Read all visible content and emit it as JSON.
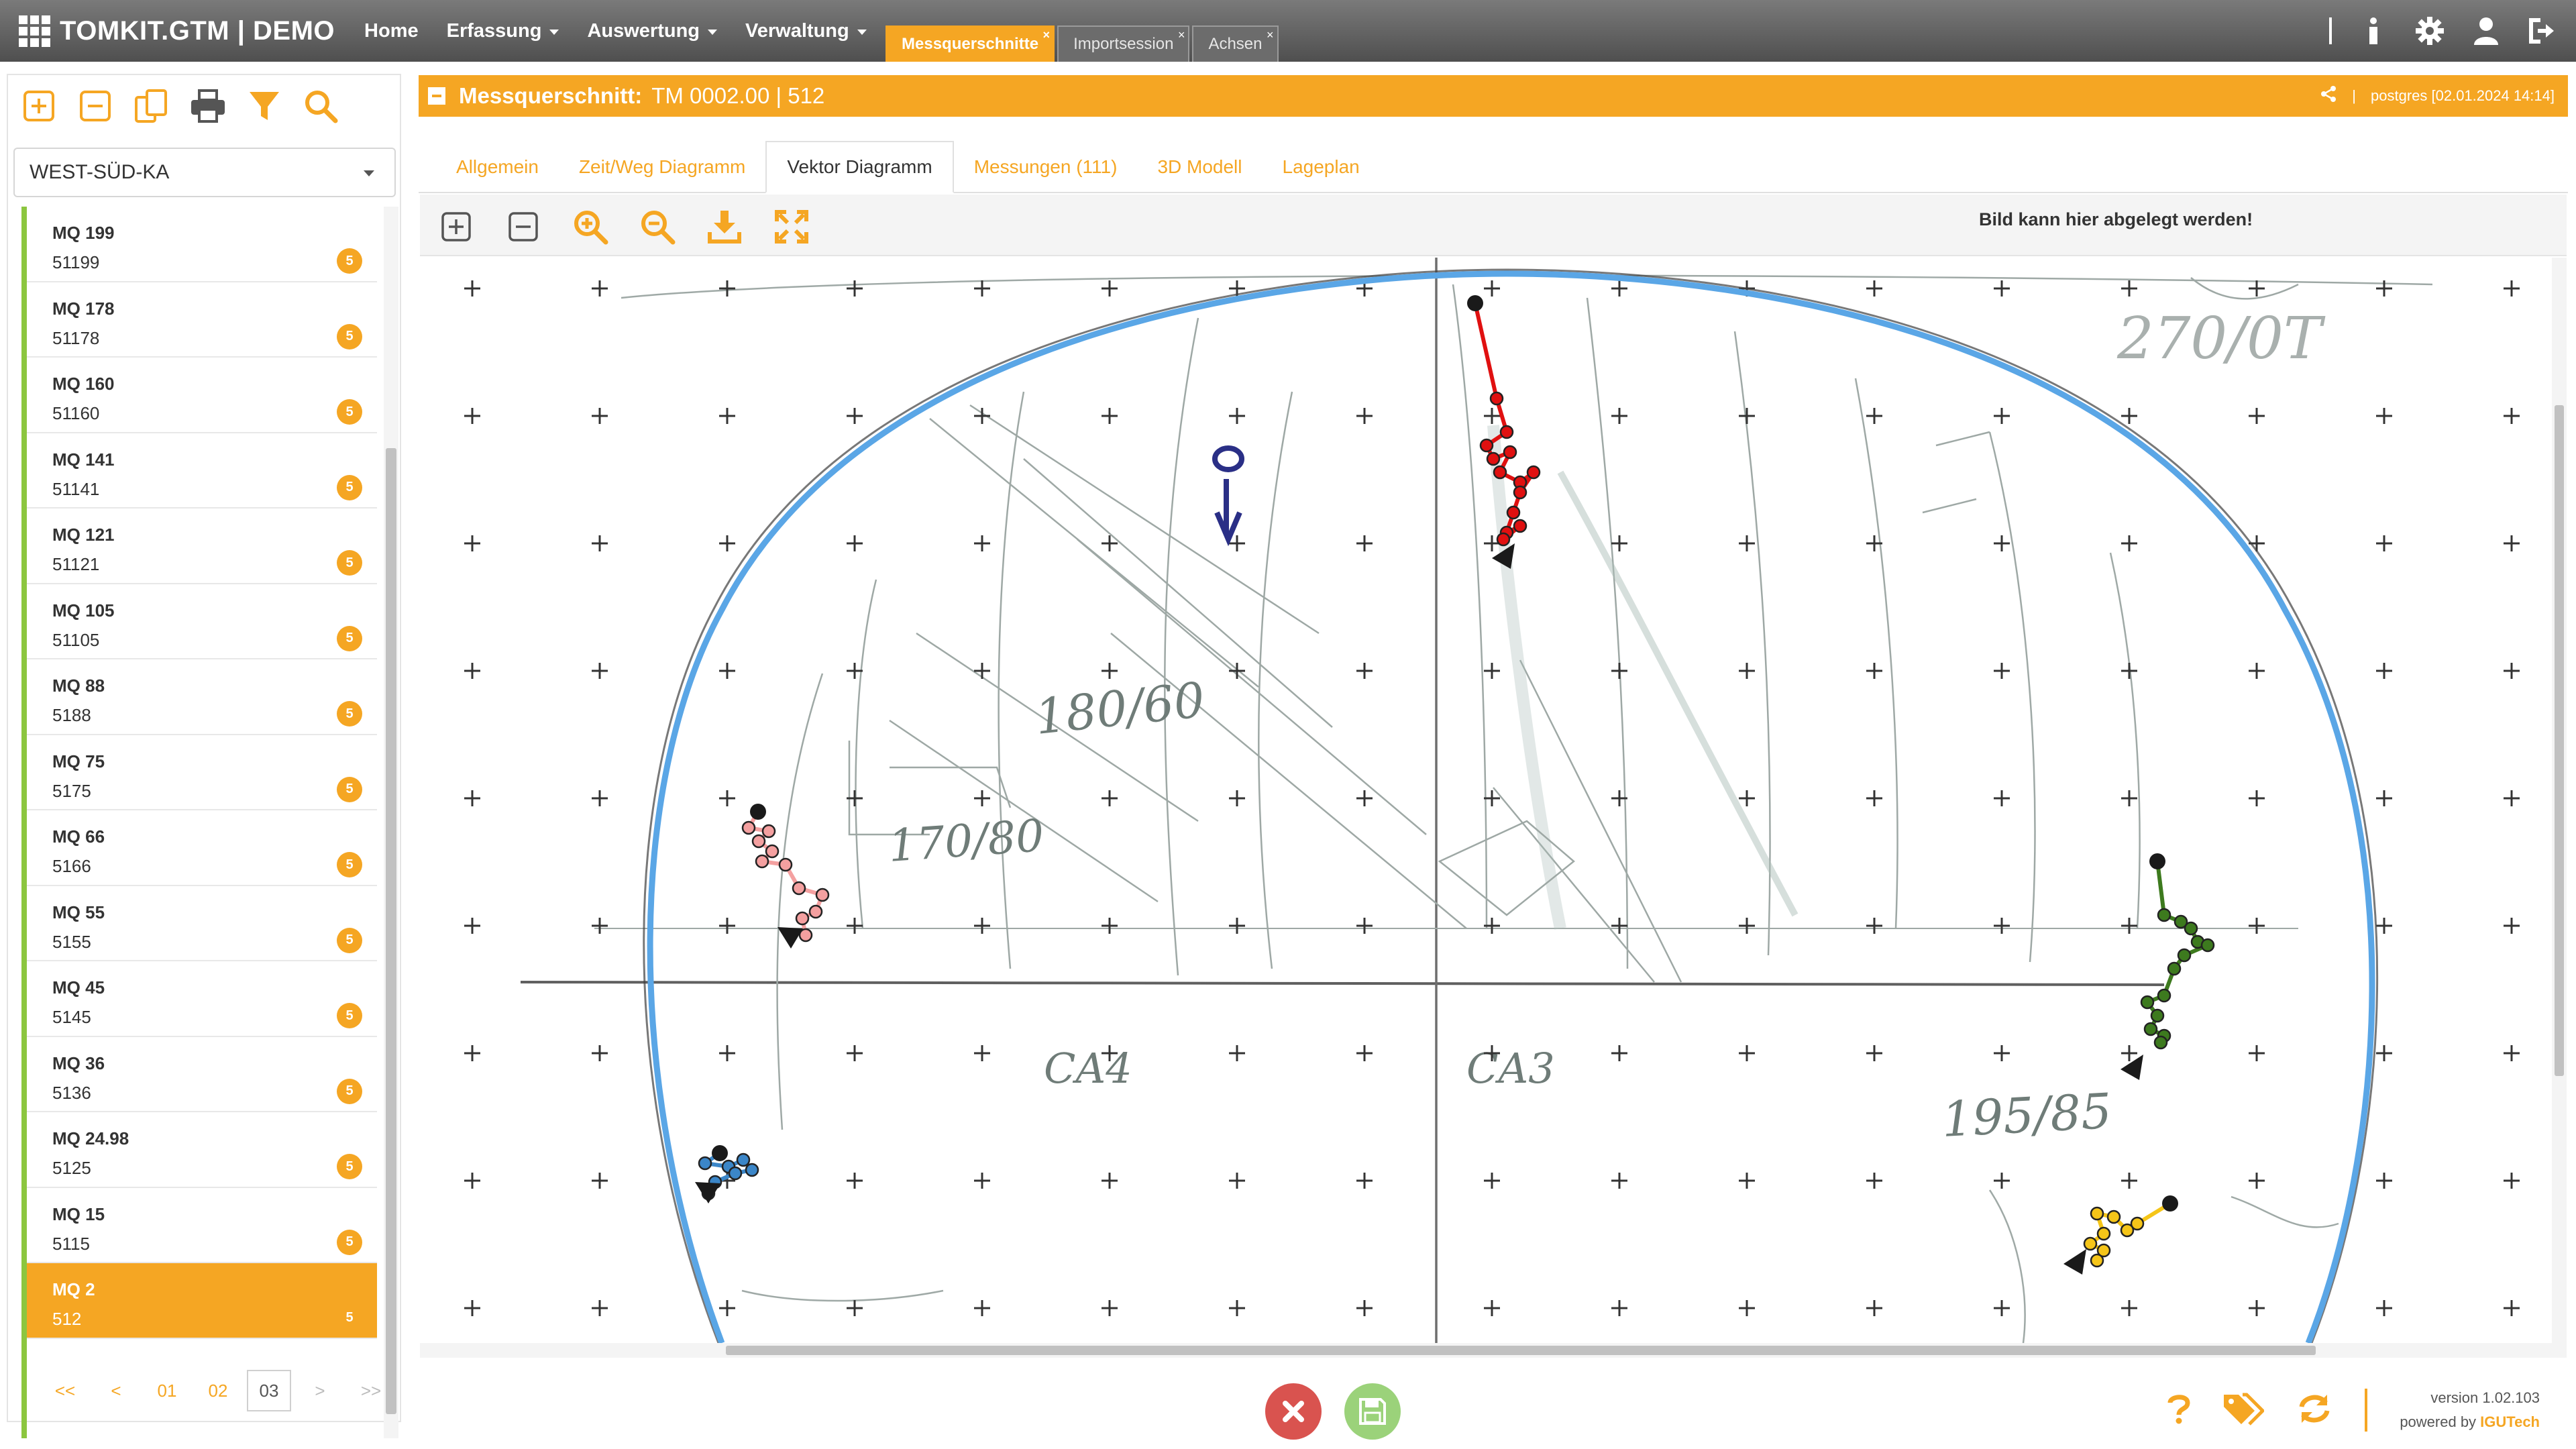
{
  "app": {
    "brand": "TOMKIT.GTM | DEMO",
    "nav": [
      {
        "label": "Home",
        "has_menu": false
      },
      {
        "label": "Erfassung",
        "has_menu": true
      },
      {
        "label": "Auswertung",
        "has_menu": true
      },
      {
        "label": "Verwaltung",
        "has_menu": true
      }
    ],
    "session_tabs": [
      {
        "label": "Messquerschnitte",
        "active": true,
        "close": "×"
      },
      {
        "label": "Importsession",
        "active": false,
        "close": "×"
      },
      {
        "label": "Achsen",
        "active": false,
        "close": "×"
      }
    ],
    "right_icons": [
      "info-icon",
      "gear-icon",
      "user-icon",
      "logout-icon"
    ]
  },
  "left": {
    "toolbar_icons": [
      "expand-all-icon",
      "collapse-all-icon",
      "copy-icon",
      "print-icon",
      "filter-icon",
      "search-icon"
    ],
    "select_value": "WEST-SÜD-KA",
    "items": [
      {
        "name": "MQ 199",
        "code": "51199",
        "badge": "5"
      },
      {
        "name": "MQ 178",
        "code": "51178",
        "badge": "5"
      },
      {
        "name": "MQ 160",
        "code": "51160",
        "badge": "5"
      },
      {
        "name": "MQ 141",
        "code": "51141",
        "badge": "5"
      },
      {
        "name": "MQ 121",
        "code": "51121",
        "badge": "5"
      },
      {
        "name": "MQ 105",
        "code": "51105",
        "badge": "5"
      },
      {
        "name": "MQ 88",
        "code": "5188",
        "badge": "5"
      },
      {
        "name": "MQ 75",
        "code": "5175",
        "badge": "5"
      },
      {
        "name": "MQ 66",
        "code": "5166",
        "badge": "5"
      },
      {
        "name": "MQ 55",
        "code": "5155",
        "badge": "5"
      },
      {
        "name": "MQ 45",
        "code": "5145",
        "badge": "5"
      },
      {
        "name": "MQ 36",
        "code": "5136",
        "badge": "5"
      },
      {
        "name": "MQ 24.98",
        "code": "5125",
        "badge": "5"
      },
      {
        "name": "MQ 15",
        "code": "5115",
        "badge": "5"
      },
      {
        "name": "MQ 2",
        "code": "512",
        "badge": "5",
        "selected": true
      }
    ],
    "pager": [
      {
        "label": "<<",
        "state": "normal"
      },
      {
        "label": "<",
        "state": "normal"
      },
      {
        "label": "01",
        "state": "normal"
      },
      {
        "label": "02",
        "state": "normal"
      },
      {
        "label": "03",
        "state": "current"
      },
      {
        "label": ">",
        "state": "disabled"
      },
      {
        "label": ">>",
        "state": "disabled"
      }
    ]
  },
  "main": {
    "title_label": "Messquerschnitt:",
    "title_value": "TM 0002.00 | 512",
    "meta": "postgres [02.01.2024 14:14]",
    "tabs": [
      {
        "label": "Allgemein",
        "active": false
      },
      {
        "label": "Zeit/Weg Diagramm",
        "active": false
      },
      {
        "label": "Vektor Diagramm",
        "active": true
      },
      {
        "label": "Messungen (111)",
        "active": false
      },
      {
        "label": "3D Modell",
        "active": false
      },
      {
        "label": "Lageplan",
        "active": false
      }
    ],
    "diagram_toolbar_icons": [
      "expand-icon",
      "collapse-icon",
      "zoom-in-icon",
      "zoom-out-icon",
      "download-icon",
      "fullscreen-icon"
    ],
    "drop_hint": "Bild kann hier abgelegt werden!",
    "sketch_texts": [
      "270/0T",
      "180/60",
      "170/80",
      "195/85",
      "CA4",
      "CA3"
    ],
    "vectors": [
      {
        "name": "crown",
        "color": "#e01010"
      },
      {
        "name": "left-upper",
        "color": "#f4a0a0"
      },
      {
        "name": "right-upper",
        "color": "#3d7a1e"
      },
      {
        "name": "left-lower",
        "color": "#3b86c8"
      },
      {
        "name": "right-lower",
        "color": "#f5c518"
      }
    ],
    "profile_color": "#5aa6e6"
  },
  "footer": {
    "version": "version 1.02.103",
    "powered_prefix": "powered by ",
    "powered_brand": "IGUTech"
  },
  "colors": {
    "accent": "#f5a623",
    "green": "#8cc63f",
    "cancel": "#d9534f",
    "save": "#9bd27a"
  }
}
